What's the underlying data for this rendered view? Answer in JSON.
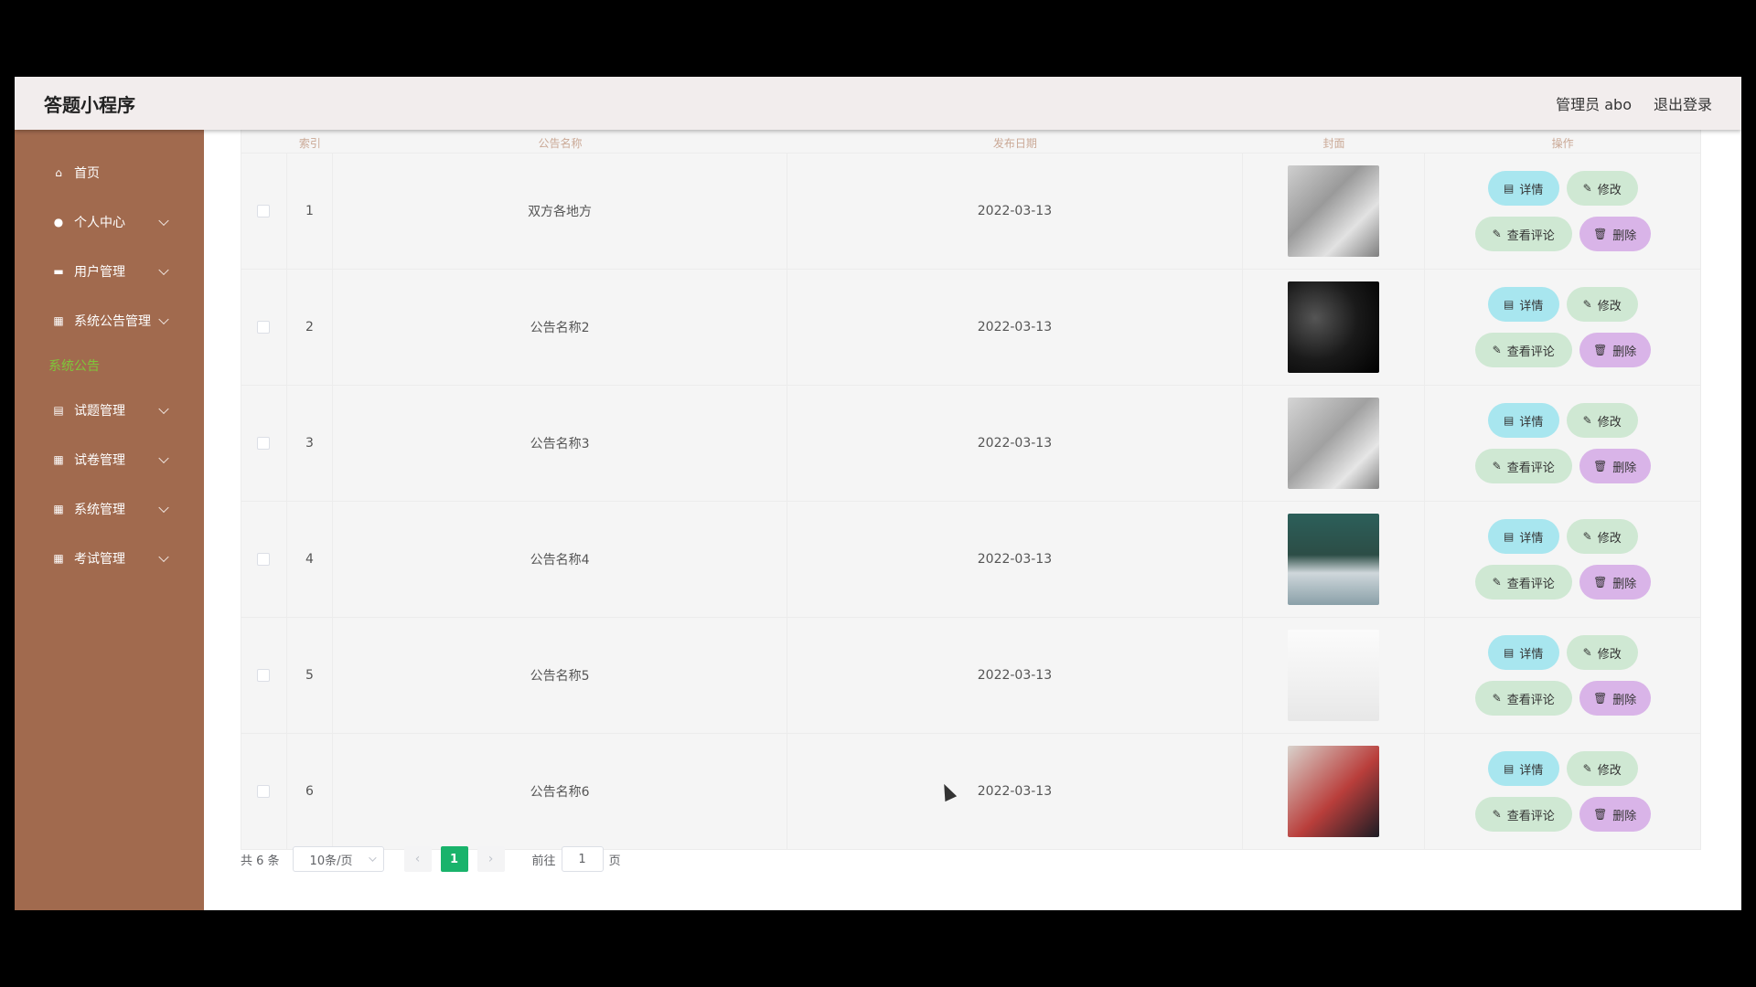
{
  "header": {
    "brand": "答题小程序",
    "user": "管理员 abo",
    "logout": "退出登录"
  },
  "sidebar": {
    "items": [
      {
        "label": "首页",
        "icon": "home-icon",
        "glyph": "⌂",
        "expandable": false
      },
      {
        "label": "个人中心",
        "icon": "user-icon",
        "glyph": "●",
        "expandable": true
      },
      {
        "label": "用户管理",
        "icon": "monitor-icon",
        "glyph": "▬",
        "expandable": true
      },
      {
        "label": "系统公告管理",
        "icon": "grid-icon",
        "glyph": "▦",
        "expandable": true
      }
    ],
    "sub_item": "系统公告",
    "items2": [
      {
        "label": "试题管理",
        "icon": "clipboard-icon",
        "glyph": "▤",
        "expandable": true
      },
      {
        "label": "试卷管理",
        "icon": "grid-icon",
        "glyph": "▦",
        "expandable": true
      },
      {
        "label": "系统管理",
        "icon": "grid-icon",
        "glyph": "▦",
        "expandable": true
      },
      {
        "label": "考试管理",
        "icon": "grid-icon",
        "glyph": "▦",
        "expandable": true
      }
    ],
    "accent": "#7ec73a",
    "bg": "#a16a4e"
  },
  "table": {
    "headers": [
      "索引",
      "公告名称",
      "发布日期",
      "封面",
      "操作"
    ],
    "rows": [
      {
        "index": "1",
        "name": "双方各地方",
        "date": "2022-03-13",
        "cover": "t1"
      },
      {
        "index": "2",
        "name": "公告名称2",
        "date": "2022-03-13",
        "cover": "t2"
      },
      {
        "index": "3",
        "name": "公告名称3",
        "date": "2022-03-13",
        "cover": "t3"
      },
      {
        "index": "4",
        "name": "公告名称4",
        "date": "2022-03-13",
        "cover": "t4"
      },
      {
        "index": "5",
        "name": "公告名称5",
        "date": "2022-03-13",
        "cover": "t5"
      },
      {
        "index": "6",
        "name": "公告名称6",
        "date": "2022-03-13",
        "cover": "t6"
      }
    ],
    "actions": {
      "detail": "详情",
      "edit": "修改",
      "comment": "查看评论",
      "delete": "删除"
    }
  },
  "pager": {
    "total": "共 6 条",
    "size": "10条/页",
    "current": "1",
    "goto_label": "前往",
    "goto_value": "1",
    "page_suffix": "页",
    "active_color": "#19b36b"
  }
}
